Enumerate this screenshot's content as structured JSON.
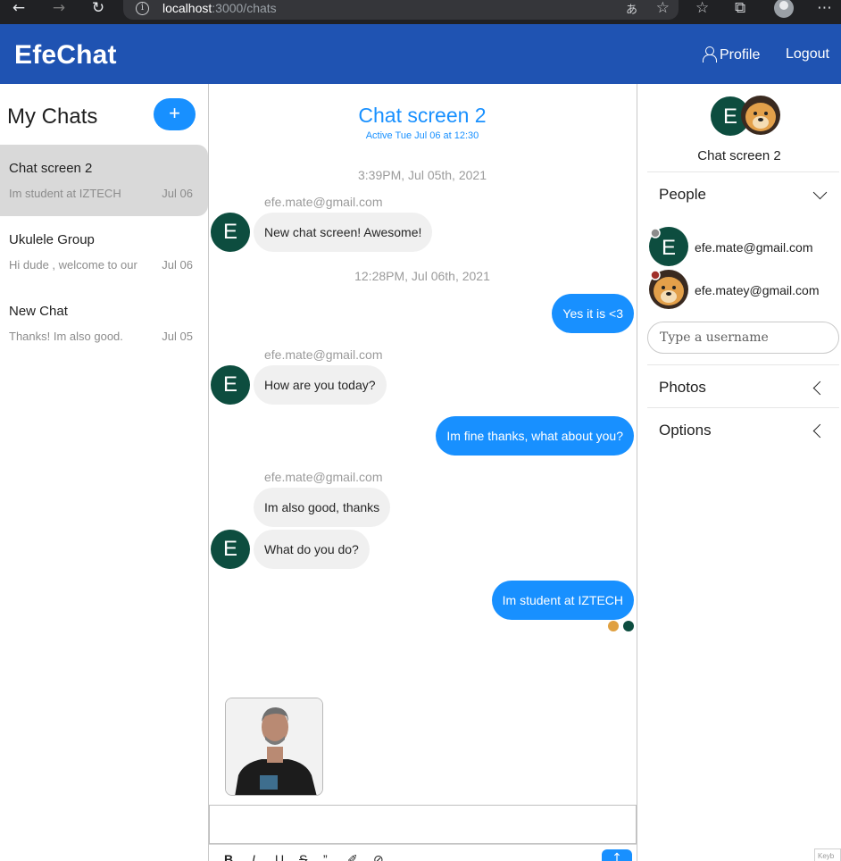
{
  "browser": {
    "url_host": "localhost",
    "url_path": ":3000/chats",
    "translate_label": "あ",
    "icons": [
      "back-icon",
      "forward-icon",
      "reload-icon",
      "info-icon",
      "favorite-add-icon",
      "favorites-icon",
      "collections-icon",
      "profile-icon",
      "more-icon"
    ]
  },
  "header": {
    "brand": "EfeChat",
    "profile_label": "Profile",
    "logout_label": "Logout",
    "bg_color": "#1f53b2"
  },
  "sidebar": {
    "title": "My Chats",
    "add_label": "+",
    "chats": [
      {
        "name": "Chat screen 2",
        "last": "Im student at IZTECH",
        "date": "Jul 06",
        "active": true
      },
      {
        "name": "Ukulele Group",
        "last": "Hi dude , welcome to our",
        "date": "Jul 06",
        "active": false
      },
      {
        "name": "New Chat",
        "last": "Thanks! Im also good.",
        "date": "Jul 05",
        "active": false
      }
    ]
  },
  "chat": {
    "title": "Chat screen 2",
    "subtitle": "Active Tue Jul 06 at 12:30",
    "timestamps": [
      "3:39PM, Jul 05th, 2021",
      "12:28PM, Jul 06th, 2021"
    ],
    "sender": "efe.mate@gmail.com",
    "avatar_letter": "E",
    "messages": [
      {
        "text": "New chat screen! Awesome!",
        "dir": "in"
      },
      {
        "text": "Yes it is <3",
        "dir": "out"
      },
      {
        "text": "How are you today?",
        "dir": "in"
      },
      {
        "text": "Im fine thanks, what about you?",
        "dir": "out"
      },
      {
        "text": "Im also good, thanks",
        "dir": "in"
      },
      {
        "text": "What do you do?",
        "dir": "in"
      },
      {
        "text": "Im student at IZTECH",
        "dir": "out"
      }
    ],
    "toolbar": [
      "B",
      "I",
      "U",
      "S",
      "”",
      "✐",
      "⊘"
    ],
    "accent": "#1890ff"
  },
  "details": {
    "title": "Chat screen 2",
    "people_label": "People",
    "members": [
      "efe.mate@gmail.com",
      "efe.matey@gmail.com"
    ],
    "username_placeholder": "Type a username",
    "photos_label": "Photos",
    "options_label": "Options"
  },
  "keyboard_hint": "Keyb"
}
